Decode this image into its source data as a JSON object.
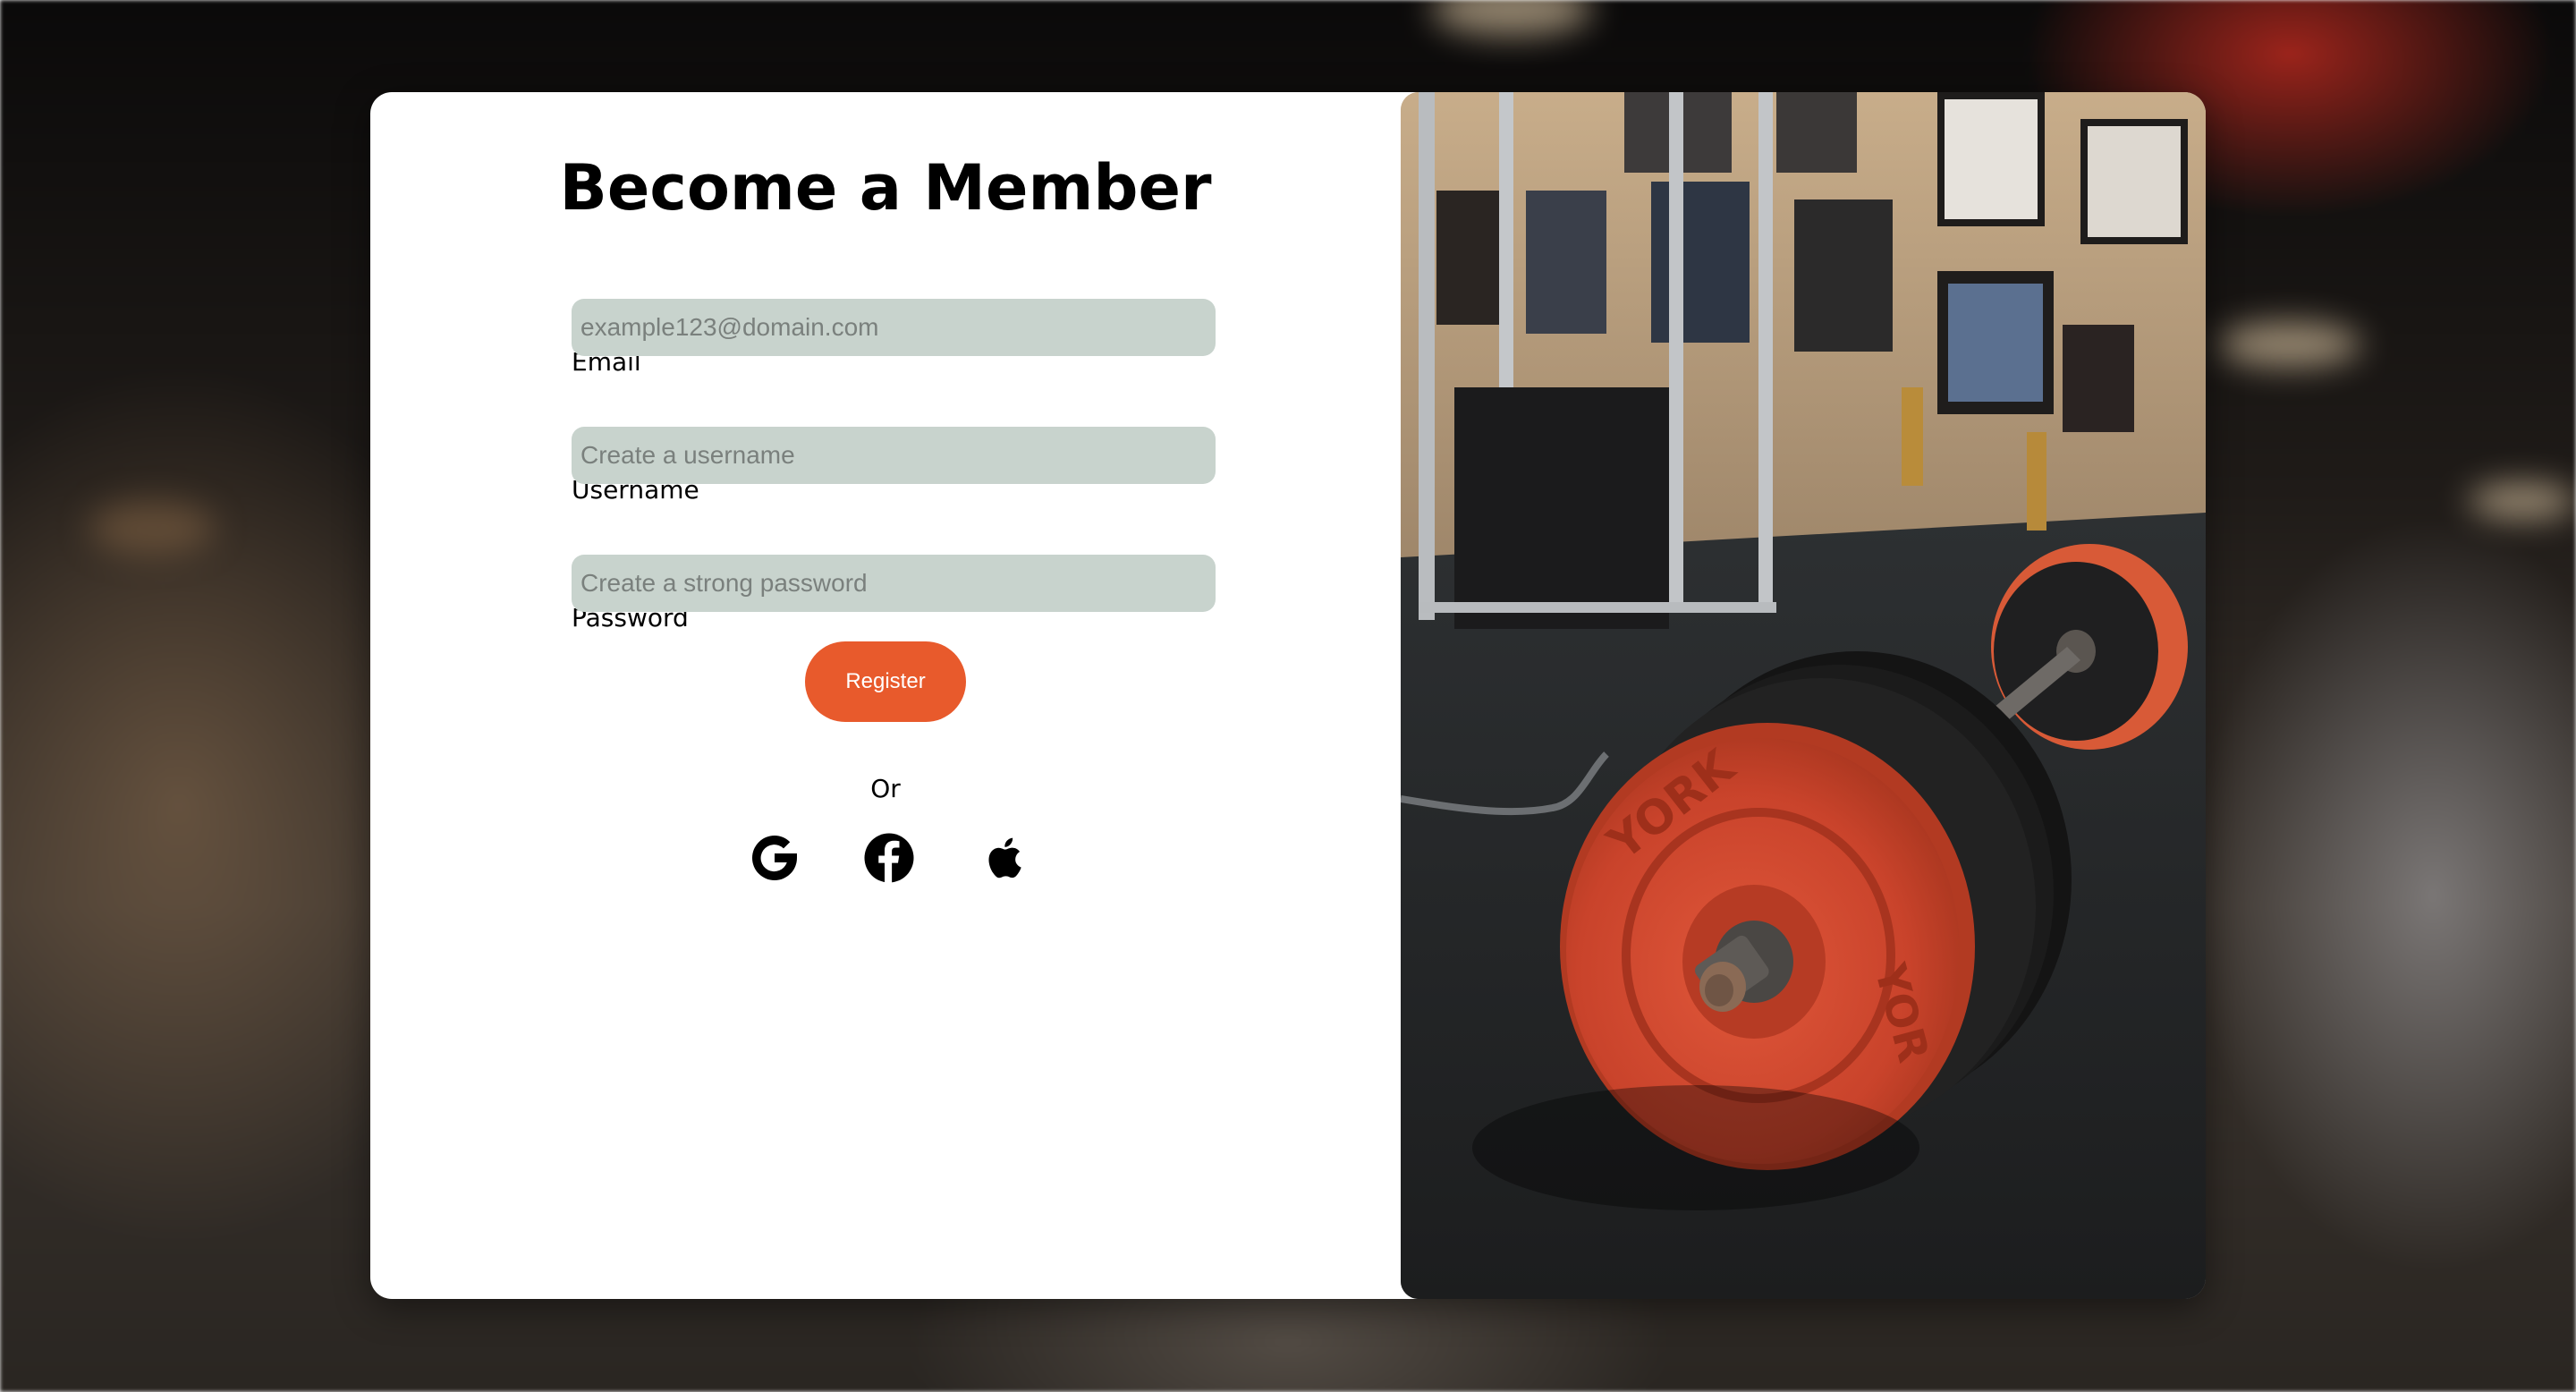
{
  "page": {
    "title": "Become a Member"
  },
  "form": {
    "email": {
      "label": "Email",
      "placeholder": "example123@domain.com"
    },
    "username": {
      "label": "Username",
      "placeholder": "Create a username"
    },
    "password": {
      "label": "Password",
      "placeholder": "Create a strong password"
    },
    "register_label": "Register",
    "divider_text": "Or"
  },
  "social": [
    {
      "icon": "google-icon"
    },
    {
      "icon": "facebook-icon"
    },
    {
      "icon": "apple-icon"
    }
  ],
  "colors": {
    "accent": "#e85a2c",
    "input_background": "#c8d3cd",
    "card_background": "#ffffff"
  },
  "image": {
    "subject": "barbell-with-york-plates"
  }
}
